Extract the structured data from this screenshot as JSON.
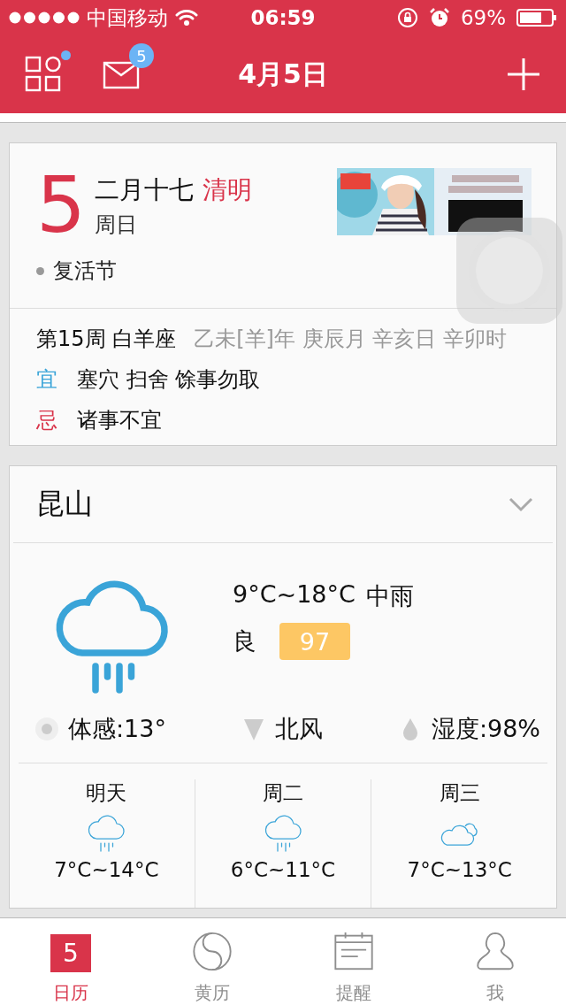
{
  "status_bar": {
    "carrier": "中国移动",
    "time": "06:59",
    "battery": "69%"
  },
  "nav": {
    "title": "4月5日",
    "unread_dot": true,
    "mail_badge": "5"
  },
  "day": {
    "number": "5",
    "lunar": "二月十七",
    "solar_term": "清明",
    "weekday": "周日",
    "festivals": [
      "复活节"
    ]
  },
  "almanac": {
    "week": "第15周 白羊座",
    "ganzhi": "乙未[羊]年 庚辰月 辛亥日 辛卯时",
    "rows": [
      {
        "kind": "good",
        "label": "宜",
        "text": "塞穴 扫舍 馀事勿取"
      },
      {
        "kind": "bad",
        "label": "忌",
        "text": "诸事不宜"
      }
    ]
  },
  "weather": {
    "city": "昆山",
    "kind": "rain",
    "range": "9°C~18°C",
    "condition": "中雨",
    "aqi_label": "良",
    "aqi": "97",
    "details": [
      {
        "kind": "feel",
        "text": "体感:13°"
      },
      {
        "kind": "wind",
        "text": "北风"
      },
      {
        "kind": "humidity",
        "text": "湿度:98%"
      }
    ],
    "forecast": [
      {
        "day": "明天",
        "kind": "rain",
        "range": "7°C~14°C"
      },
      {
        "day": "周二",
        "kind": "rain",
        "range": "6°C~11°C"
      },
      {
        "day": "周三",
        "kind": "cloudy",
        "range": "7°C~13°C"
      }
    ]
  },
  "tabs": [
    {
      "kind": "calendar",
      "label": "日历",
      "icon_text": "5",
      "selected": true
    },
    {
      "kind": "almanac",
      "label": "黄历",
      "selected": false
    },
    {
      "kind": "reminder",
      "label": "提醒",
      "selected": false
    },
    {
      "kind": "me",
      "label": "我",
      "selected": false
    }
  ]
}
